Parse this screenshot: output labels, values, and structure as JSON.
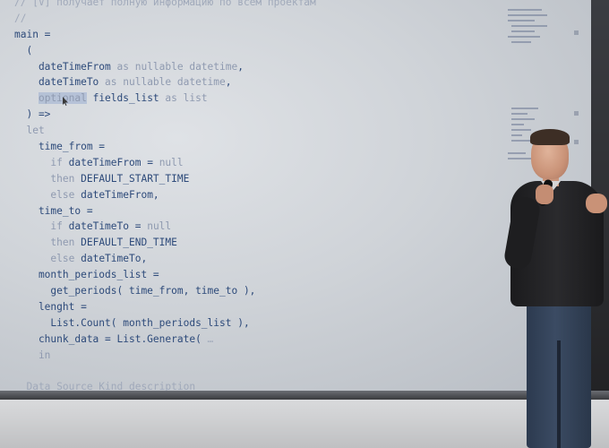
{
  "code_lines": [
    {
      "parts": [
        {
          "t": "// [V] получает полную информацию по всем проектам",
          "c": "faded"
        }
      ]
    },
    {
      "parts": [
        {
          "t": "//",
          "c": "faded"
        }
      ]
    },
    {
      "parts": [
        {
          "t": "main =",
          "c": ""
        }
      ]
    },
    {
      "parts": [
        {
          "t": "  (",
          "c": ""
        }
      ]
    },
    {
      "parts": [
        {
          "t": "    dateTimeFrom ",
          "c": ""
        },
        {
          "t": "as nullable datetime",
          "c": "kw"
        },
        {
          "t": ",",
          "c": ""
        }
      ]
    },
    {
      "parts": [
        {
          "t": "    dateTimeTo ",
          "c": ""
        },
        {
          "t": "as nullable datetime",
          "c": "kw"
        },
        {
          "t": ",",
          "c": ""
        }
      ]
    },
    {
      "parts": [
        {
          "t": "    ",
          "c": ""
        },
        {
          "t": "optional",
          "c": "kw sel"
        },
        {
          "t": " fields_list ",
          "c": ""
        },
        {
          "t": "as list",
          "c": "kw"
        }
      ]
    },
    {
      "parts": [
        {
          "t": "  ) =>",
          "c": ""
        }
      ]
    },
    {
      "parts": [
        {
          "t": "  let",
          "c": "kw"
        }
      ]
    },
    {
      "parts": [
        {
          "t": "    time_from =",
          "c": ""
        }
      ]
    },
    {
      "parts": [
        {
          "t": "      ",
          "c": ""
        },
        {
          "t": "if",
          "c": "kw"
        },
        {
          "t": " dateTimeFrom = ",
          "c": ""
        },
        {
          "t": "null",
          "c": "kw"
        }
      ]
    },
    {
      "parts": [
        {
          "t": "      ",
          "c": ""
        },
        {
          "t": "then",
          "c": "kw"
        },
        {
          "t": " DEFAULT_START_TIME",
          "c": ""
        }
      ]
    },
    {
      "parts": [
        {
          "t": "      ",
          "c": ""
        },
        {
          "t": "else",
          "c": "kw"
        },
        {
          "t": " dateTimeFrom,",
          "c": ""
        }
      ]
    },
    {
      "parts": [
        {
          "t": "    time_to =",
          "c": ""
        }
      ]
    },
    {
      "parts": [
        {
          "t": "      ",
          "c": ""
        },
        {
          "t": "if",
          "c": "kw"
        },
        {
          "t": " dateTimeTo = ",
          "c": ""
        },
        {
          "t": "null",
          "c": "kw"
        }
      ]
    },
    {
      "parts": [
        {
          "t": "      ",
          "c": ""
        },
        {
          "t": "then",
          "c": "kw"
        },
        {
          "t": " DEFAULT_END_TIME",
          "c": ""
        }
      ]
    },
    {
      "parts": [
        {
          "t": "      ",
          "c": ""
        },
        {
          "t": "else",
          "c": "kw"
        },
        {
          "t": " dateTimeTo,",
          "c": ""
        }
      ]
    },
    {
      "parts": [
        {
          "t": "    month_periods_list =",
          "c": ""
        }
      ]
    },
    {
      "parts": [
        {
          "t": "      get_periods( time_from, time_to ),",
          "c": ""
        }
      ]
    },
    {
      "parts": [
        {
          "t": "    lenght =",
          "c": ""
        }
      ]
    },
    {
      "parts": [
        {
          "t": "      List.Count( month_periods_list ),",
          "c": ""
        }
      ]
    },
    {
      "parts": [
        {
          "t": "    chunk_data = List.Generate( ",
          "c": ""
        },
        {
          "t": "…",
          "c": "faded"
        }
      ]
    },
    {
      "parts": [
        {
          "t": "    in",
          "c": "kw"
        }
      ]
    },
    {
      "parts": [
        {
          "t": "",
          "c": ""
        }
      ]
    },
    {
      "parts": [
        {
          "t": "  Data Source Kind description",
          "c": "faded"
        }
      ]
    }
  ],
  "colors": {
    "code_text": "#2d4a7a",
    "keyword": "#8f9ab0",
    "screen": "#d5d8dd"
  }
}
